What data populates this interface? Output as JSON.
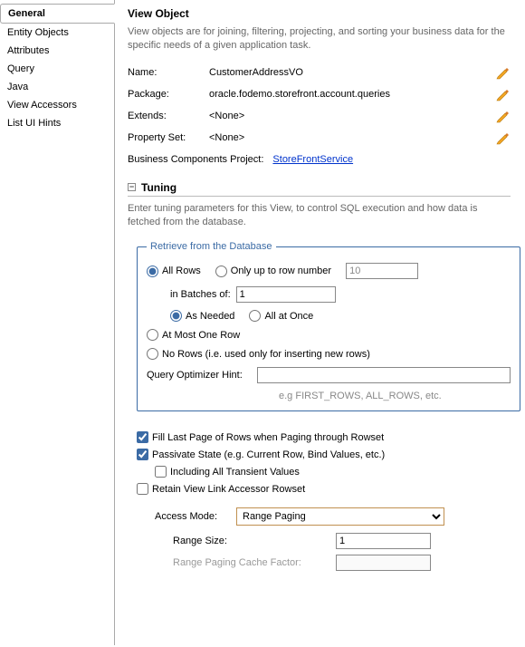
{
  "sidebar": {
    "items": [
      {
        "label": "General"
      },
      {
        "label": "Entity Objects"
      },
      {
        "label": "Attributes"
      },
      {
        "label": "Query"
      },
      {
        "label": "Java"
      },
      {
        "label": "View Accessors"
      },
      {
        "label": "List UI Hints"
      }
    ]
  },
  "main": {
    "title": "View Object",
    "desc": "View objects are for joining, filtering, projecting, and sorting your business data for the specific needs of a given application task.",
    "fields": {
      "name_label": "Name:",
      "name_value": "CustomerAddressVO",
      "package_label": "Package:",
      "package_value": "oracle.fodemo.storefront.account.queries",
      "extends_label": "Extends:",
      "extends_value": "<None>",
      "propset_label": "Property Set:",
      "propset_value": "<None>",
      "bcp_label": "Business Components Project:",
      "bcp_link": "StoreFrontService"
    }
  },
  "tuning": {
    "header": "Tuning",
    "desc": "Enter tuning parameters for this View, to control SQL execution and how data is fetched from the database.",
    "fieldset_legend": "Retrieve from the Database",
    "all_rows": "All Rows",
    "only_upto": "Only up to row number",
    "only_upto_value": "10",
    "batches_label": "in Batches of:",
    "batches_value": "1",
    "as_needed": "As Needed",
    "all_at_once": "All at Once",
    "at_most_one": "At Most One Row",
    "no_rows": "No Rows (i.e. used only for inserting new rows)",
    "hint_label": "Query Optimizer Hint:",
    "hint_value": "",
    "hint_note": "e.g FIRST_ROWS, ALL_ROWS, etc.",
    "fill_last": "Fill Last Page of Rows when Paging through Rowset",
    "passivate": "Passivate State (e.g. Current Row, Bind Values, etc.)",
    "include_transient": "Including All Transient Values",
    "retain_vla": "Retain View Link Accessor Rowset",
    "access_mode_label": "Access Mode:",
    "access_mode_value": "Range Paging",
    "range_size_label": "Range Size:",
    "range_size_value": "1",
    "cache_factor_label": "Range Paging Cache Factor:",
    "cache_factor_value": ""
  }
}
